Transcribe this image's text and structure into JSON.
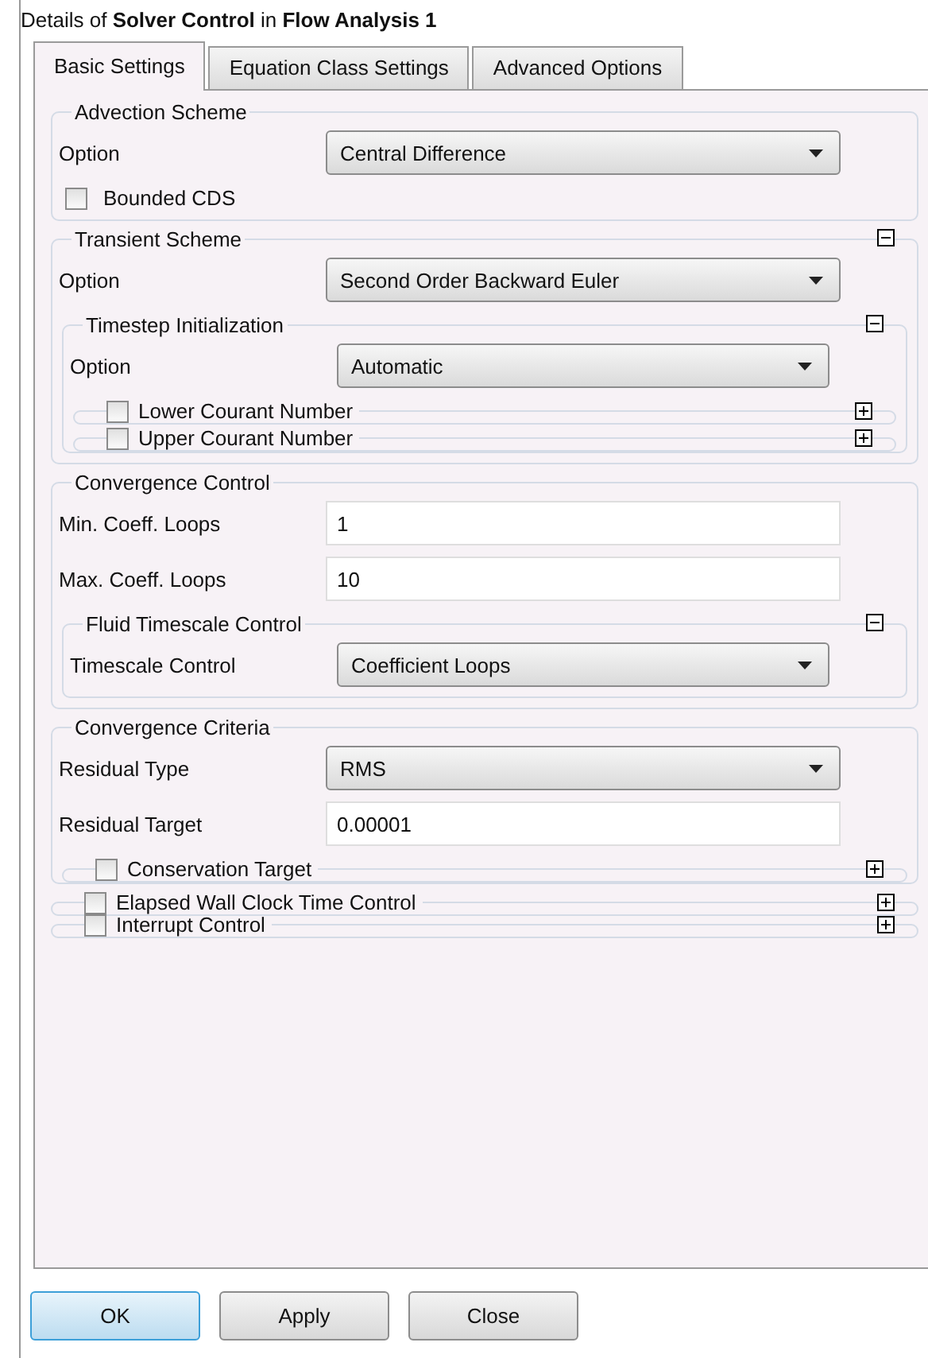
{
  "title": "Details of **Solver Control** in **Flow Analysis 1**",
  "tabs": [
    {
      "label": "Basic Settings",
      "selected": true
    },
    {
      "label": "Equation Class Settings",
      "selected": false
    },
    {
      "label": "Advanced Options",
      "selected": false
    }
  ],
  "sections": [
    {
      "kind": "group",
      "title": "Advection Scheme",
      "items": [
        {
          "kind": "select",
          "label": "Option",
          "value": "Central Difference"
        },
        {
          "kind": "checkbox",
          "label": "Bounded CDS",
          "checked": false
        }
      ]
    },
    {
      "kind": "group",
      "title": "Transient Scheme",
      "expanded": true,
      "items": [
        {
          "kind": "select",
          "label": "Option",
          "value": "Second Order Backward Euler"
        },
        {
          "kind": "group",
          "title": "Timestep Initialization",
          "expanded": true,
          "items": [
            {
              "kind": "select",
              "label": "Option",
              "value": "Automatic"
            },
            {
              "kind": "optional",
              "label": "Lower Courant Number",
              "checked": false,
              "expanded": false
            },
            {
              "kind": "optional",
              "label": "Upper Courant Number",
              "checked": false,
              "expanded": false
            }
          ]
        }
      ]
    },
    {
      "kind": "group",
      "title": "Convergence Control",
      "items": [
        {
          "kind": "text",
          "label": "Min. Coeff. Loops",
          "value": "1"
        },
        {
          "kind": "text",
          "label": "Max. Coeff. Loops",
          "value": "10"
        },
        {
          "kind": "group",
          "title": "Fluid Timescale Control",
          "expanded": true,
          "items": [
            {
              "kind": "select",
              "label": "Timescale Control",
              "value": "Coefficient Loops"
            }
          ]
        }
      ]
    },
    {
      "kind": "group",
      "title": "Convergence Criteria",
      "items": [
        {
          "kind": "select",
          "label": "Residual Type",
          "value": "RMS"
        },
        {
          "kind": "text",
          "label": "Residual Target",
          "value": "0.00001"
        },
        {
          "kind": "optional",
          "label": "Conservation Target",
          "checked": false,
          "expanded": false
        }
      ]
    },
    {
      "kind": "optional",
      "label": "Elapsed Wall Clock Time Control",
      "checked": false,
      "expanded": false
    },
    {
      "kind": "optional",
      "label": "Interrupt Control",
      "checked": false,
      "expanded": false
    }
  ],
  "buttons": [
    {
      "label": "OK",
      "default": true
    },
    {
      "label": "Apply",
      "default": false
    },
    {
      "label": "Close",
      "default": false
    }
  ]
}
